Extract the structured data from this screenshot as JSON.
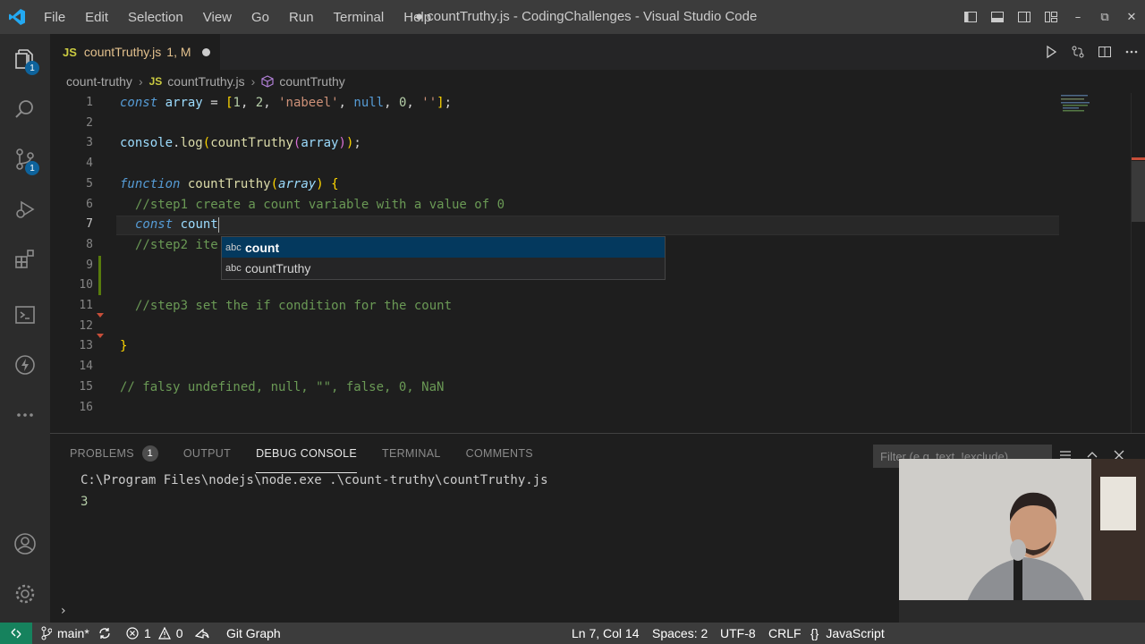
{
  "titlebar": {
    "menu": [
      "File",
      "Edit",
      "Selection",
      "View",
      "Go",
      "Run",
      "Terminal",
      "Help"
    ],
    "title": "● countTruthy.js - CodingChallenges - Visual Studio Code"
  },
  "activity": {
    "explorer_badge": "1",
    "scm_badge": "1"
  },
  "tab": {
    "lang": "JS",
    "label": "countTruthy.js",
    "status": "1, M"
  },
  "breadcrumb": {
    "folder": "count-truthy",
    "lang": "JS",
    "file": "countTruthy.js",
    "symbol": "countTruthy"
  },
  "editor": {
    "line_numbers": [
      "1",
      "2",
      "3",
      "4",
      "5",
      "6",
      "7",
      "8",
      "9",
      "10",
      "11",
      "12",
      "13",
      "14",
      "15",
      "16"
    ],
    "suggestions": [
      {
        "kind": "abc",
        "label": "count"
      },
      {
        "kind": "abc",
        "label": "countTruthy"
      }
    ]
  },
  "panel": {
    "tabs": [
      "PROBLEMS",
      "OUTPUT",
      "DEBUG CONSOLE",
      "TERMINAL",
      "COMMENTS"
    ],
    "problems_count": "1",
    "filter_placeholder": "Filter (e.g. text, !exclude)",
    "output_lines": [
      "C:\\Program Files\\nodejs\\node.exe .\\count-truthy\\countTruthy.js",
      "3"
    ]
  },
  "status": {
    "branch": "main*",
    "errors": "1",
    "warnings": "0",
    "git_graph": "Git Graph",
    "position": "Ln 7, Col 14",
    "spaces": "Spaces: 2",
    "encoding": "UTF-8",
    "eol": "CRLF",
    "language": "JavaScript"
  },
  "colors": {
    "accent": "#0e639c",
    "remote": "#16825d",
    "titlebar": "#3c3c3c"
  }
}
